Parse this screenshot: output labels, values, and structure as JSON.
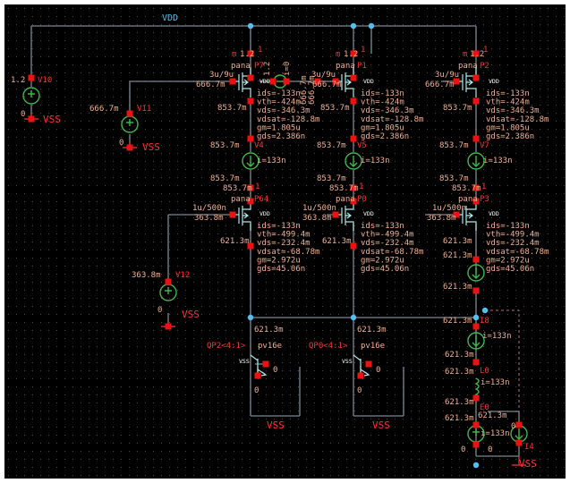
{
  "nets": {
    "vdd": "VDD"
  },
  "sources": {
    "v10": {
      "value": "1.2",
      "name": "V10",
      "neg": "0",
      "vss": "VSS"
    },
    "v11": {
      "value": "666.7m",
      "name": "V11",
      "neg": "0",
      "vss": "VSS"
    },
    "v12": {
      "value": "363.8m",
      "name": "V12",
      "neg": "0",
      "vss": "VSS"
    }
  },
  "bias": {
    "nodeA": "1.2",
    "current": "i=0",
    "nodeB": "666.7m",
    "nodeC": "666.7m"
  },
  "mos": {
    "p7": {
      "m": "m",
      "mval": "1.2",
      "count": "1",
      "model": "pana",
      "name": "P7",
      "wl": "3u/9u",
      "vg": "666.7m",
      "vd": "853.7m"
    },
    "p1": {
      "m": "m",
      "mval": "1.2",
      "count": "1",
      "model": "pana",
      "name": "P1",
      "wl": "3u/9u",
      "vg": "666.7m",
      "vd": "853.7m"
    },
    "p2": {
      "m": "m",
      "mval": "1.2",
      "count": "1",
      "model": "pana",
      "name": "P2",
      "wl": "3u/9u",
      "vg": "666.7m",
      "vd": "853.7m"
    },
    "p64": {
      "model": "pana",
      "name": "P64",
      "wl": "1u/500n",
      "vg": "363.8m",
      "vd": "621.3m"
    },
    "p0": {
      "model": "pana",
      "name": "P0",
      "wl": "1u/500n",
      "vg": "363.8m",
      "vd": "621.3m"
    },
    "p3": {
      "model": "pana",
      "name": "P3",
      "wl": "1u/500n",
      "vg": "363.8m",
      "vd": "621.3m"
    }
  },
  "op_upper": [
    "ids=-133n",
    "vth=-424m",
    "vds=-346.3m",
    "vdsat=-128.8m",
    "gm=1.805u",
    "gds=2.386n"
  ],
  "op_lower": [
    "ids=-133n",
    "vth=-499.4m",
    "vds=-232.4m",
    "vdsat=-68.78m",
    "gm=2.972u",
    "gds=45.06n"
  ],
  "col": {
    "p7": {
      "v1": "853.7m",
      "iname": "V4",
      "ival": "i=133n",
      "v2": "853.7m",
      "count2": "1",
      "v3": "853.7m"
    },
    "p1": {
      "v1": "853.7m",
      "iname": "V5",
      "ival": "i=133n",
      "v2": "853.7m",
      "count2": "1",
      "v3": "853.7m"
    },
    "p2": {
      "v1": "853.7m",
      "iname": "V7",
      "ival": "i=133n",
      "v2": "853.7m",
      "count2": "1",
      "v3": "853.7m"
    }
  },
  "right": {
    "v1": "621.3m",
    "v2": "621.3m",
    "v3": "621.3m",
    "i8name": "I8",
    "i8val": "i=133n",
    "v4": "621.3m",
    "l0name": "L0",
    "v5": "621.3m",
    "l0ival": "i=133n",
    "v6": "621.3m",
    "e0name": "E0",
    "v7": "621.3m",
    "v8": "621.3m",
    "e0ival": "i=133n",
    "neg1": "0",
    "neg2": "0",
    "i4name": "I4",
    "vss": "VSS",
    "i4val": "0"
  },
  "bjt": {
    "qp2": {
      "vbus": "621.3m",
      "name": "QP2<4:1>",
      "model": "pv16e",
      "vss": "VSS",
      "z1": "0",
      "z2": "0",
      "ground": "VSS"
    },
    "qp0": {
      "vbus": "621.3m",
      "name": "QP0<4:1>",
      "model": "pv16e",
      "vss": "VSS",
      "z1": "0",
      "z2": "0",
      "ground": "VSS"
    }
  },
  "mos_body_label": "VDD"
}
